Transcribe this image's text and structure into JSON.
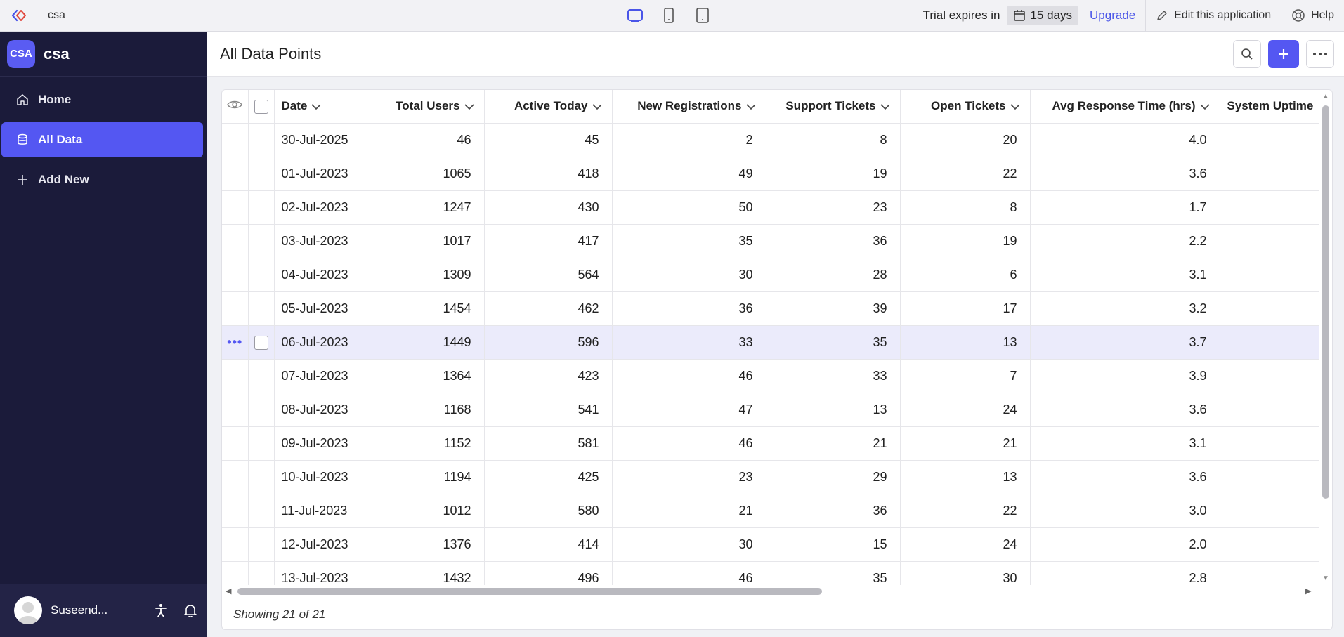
{
  "topbar": {
    "app_name": "csa",
    "trial_text": "Trial expires in",
    "trial_days": "15 days",
    "upgrade_label": "Upgrade",
    "edit_label": "Edit this application",
    "help_label": "Help"
  },
  "sidebar": {
    "badge": "CSA",
    "app_name": "csa",
    "items": [
      {
        "label": "Home",
        "icon": "home-icon"
      },
      {
        "label": "All Data",
        "icon": "database-icon",
        "active": true
      },
      {
        "label": "Add New",
        "icon": "plus-icon"
      }
    ],
    "user_name": "Suseend..."
  },
  "main": {
    "title": "All Data Points",
    "columns": [
      "Date",
      "Total Users",
      "Active Today",
      "New Registrations",
      "Support Tickets",
      "Open Tickets",
      "Avg Response Time (hrs)",
      "System Uptime"
    ],
    "rows": [
      [
        "30-Jul-2025",
        "46",
        "45",
        "2",
        "8",
        "20",
        "4.0"
      ],
      [
        "01-Jul-2023",
        "1065",
        "418",
        "49",
        "19",
        "22",
        "3.6"
      ],
      [
        "02-Jul-2023",
        "1247",
        "430",
        "50",
        "23",
        "8",
        "1.7"
      ],
      [
        "03-Jul-2023",
        "1017",
        "417",
        "35",
        "36",
        "19",
        "2.2"
      ],
      [
        "04-Jul-2023",
        "1309",
        "564",
        "30",
        "28",
        "6",
        "3.1"
      ],
      [
        "05-Jul-2023",
        "1454",
        "462",
        "36",
        "39",
        "17",
        "3.2"
      ],
      [
        "06-Jul-2023",
        "1449",
        "596",
        "33",
        "35",
        "13",
        "3.7"
      ],
      [
        "07-Jul-2023",
        "1364",
        "423",
        "46",
        "33",
        "7",
        "3.9"
      ],
      [
        "08-Jul-2023",
        "1168",
        "541",
        "47",
        "13",
        "24",
        "3.6"
      ],
      [
        "09-Jul-2023",
        "1152",
        "581",
        "46",
        "21",
        "21",
        "3.1"
      ],
      [
        "10-Jul-2023",
        "1194",
        "425",
        "23",
        "29",
        "13",
        "3.6"
      ],
      [
        "11-Jul-2023",
        "1012",
        "580",
        "21",
        "36",
        "22",
        "3.0"
      ],
      [
        "12-Jul-2023",
        "1376",
        "414",
        "30",
        "15",
        "24",
        "2.0"
      ],
      [
        "13-Jul-2023",
        "1432",
        "496",
        "46",
        "35",
        "30",
        "2.8"
      ]
    ],
    "highlighted_row": 6,
    "footer": "Showing 21 of 21"
  },
  "colors": {
    "accent": "#5457f2",
    "sidebar_bg": "#1b1b3a",
    "row_highlight": "#ebebfb"
  }
}
